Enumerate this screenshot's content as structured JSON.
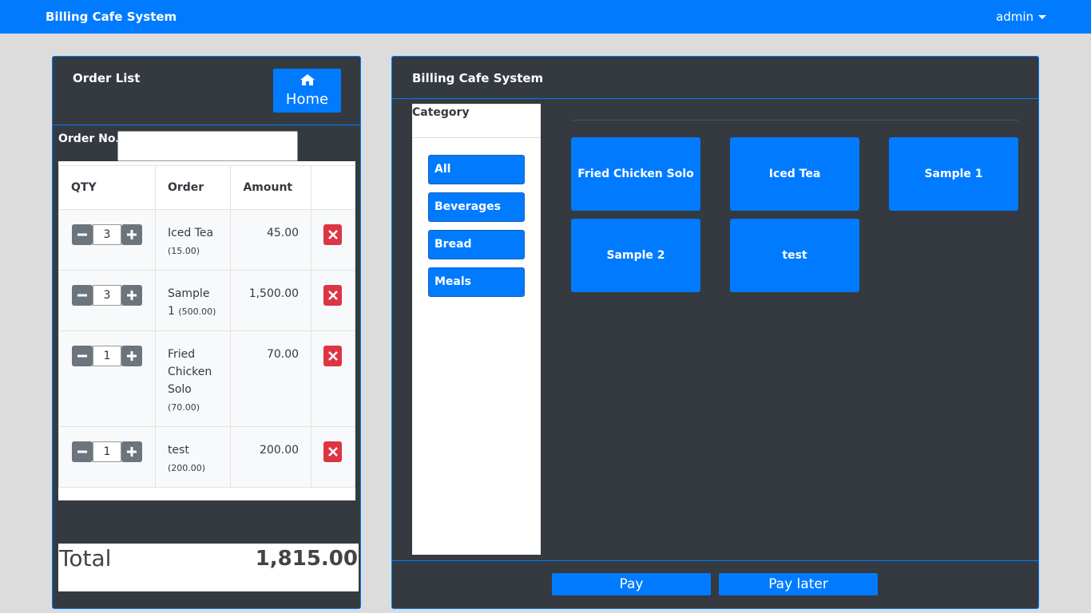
{
  "navbar": {
    "brand": "Billing Cafe System",
    "user": "admin"
  },
  "order_panel": {
    "title": "Order List",
    "home_label": "Home",
    "order_no_label": "Order No.",
    "order_no_value": "",
    "columns": [
      "QTY",
      "Order",
      "Amount",
      ""
    ],
    "items": [
      {
        "qty": "3",
        "name": "Iced Tea",
        "price": "(15.00)",
        "amount": "45.00"
      },
      {
        "qty": "3",
        "name": "Sample 1",
        "price": "(500.00)",
        "amount": "1,500.00"
      },
      {
        "qty": "1",
        "name": "Fried Chicken Solo",
        "price": "(70.00)",
        "amount": "70.00"
      },
      {
        "qty": "1",
        "name": "test",
        "price": "(200.00)",
        "amount": "200.00"
      }
    ],
    "total_label": "Total",
    "total_value": "1,815.00"
  },
  "main_panel": {
    "title": "Billing Cafe System",
    "category_title": "Category",
    "categories": [
      "All",
      "Beverages",
      "Bread",
      "Meals"
    ],
    "products": [
      "Fried Chicken Solo",
      "Iced Tea",
      "Sample 1",
      "Sample 2",
      "test"
    ],
    "pay_label": "Pay",
    "pay_later_label": "Pay later"
  },
  "icons": {
    "home": "home-icon",
    "minus": "minus-icon",
    "plus": "plus-icon",
    "delete": "times-icon",
    "dropdown": "caret-down-icon"
  },
  "colors": {
    "primary": "#007bff",
    "dark": "#343a40",
    "danger": "#dc3545",
    "secondary": "#6c757d"
  }
}
